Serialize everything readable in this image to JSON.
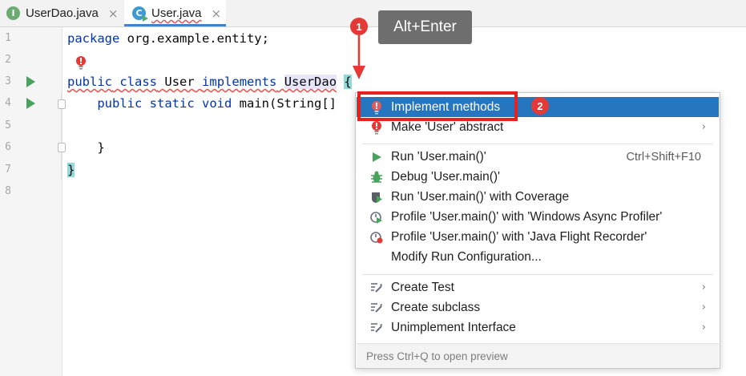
{
  "tabs": [
    {
      "label": "UserDao.java",
      "icon": "interface-file-icon",
      "icon_letter": "I",
      "close": "×"
    },
    {
      "label": "User.java",
      "icon": "class-file-icon",
      "icon_letter": "C",
      "close": "×",
      "active": true
    }
  ],
  "line_numbers": [
    "1",
    "2",
    "3",
    "4",
    "5",
    "6",
    "7",
    "8"
  ],
  "code": {
    "l1_kw": "package",
    "l1_rest": " org.example.entity;",
    "l3_kw1": "public",
    "l3_kw2": "class",
    "l3_name": "User",
    "l3_kw3": "implements",
    "l3_iface": "UserDao",
    "l3_brace": "{",
    "l4_kw1": "public",
    "l4_kw2": "static",
    "l4_kw3": "void",
    "l4_rest": " main(String[]",
    "l6": "}",
    "l7": "}"
  },
  "annotations": {
    "badge1": "1",
    "badge2": "2",
    "tooltip": "Alt+Enter"
  },
  "menu": {
    "items": [
      {
        "label": "Implement methods",
        "icon": "error-bulb-icon",
        "selected": true
      },
      {
        "label": "Make 'User' abstract",
        "icon": "error-bulb-icon",
        "arrow": "›"
      },
      {
        "label": "Run 'User.main()'",
        "icon": "run-icon",
        "shortcut": "Ctrl+Shift+F10"
      },
      {
        "label": "Debug 'User.main()'",
        "icon": "debug-icon"
      },
      {
        "label": "Run 'User.main()' with Coverage",
        "icon": "coverage-icon"
      },
      {
        "label": "Profile 'User.main()' with 'Windows Async Profiler'",
        "icon": "profiler-icon"
      },
      {
        "label": "Profile 'User.main()' with 'Java Flight Recorder'",
        "icon": "flight-recorder-icon"
      },
      {
        "label": "Modify Run Configuration...",
        "icon": ""
      },
      {
        "label": "Create Test",
        "icon": "intention-icon",
        "arrow": "›"
      },
      {
        "label": "Create subclass",
        "icon": "intention-icon",
        "arrow": "›"
      },
      {
        "label": "Unimplement Interface",
        "icon": "intention-icon",
        "arrow": "›"
      }
    ],
    "footer": "Press Ctrl+Q to open preview"
  },
  "colors": {
    "selection": "#2675bf",
    "keyword": "#0033b3",
    "error": "#e53935",
    "run": "#4aa35d"
  }
}
